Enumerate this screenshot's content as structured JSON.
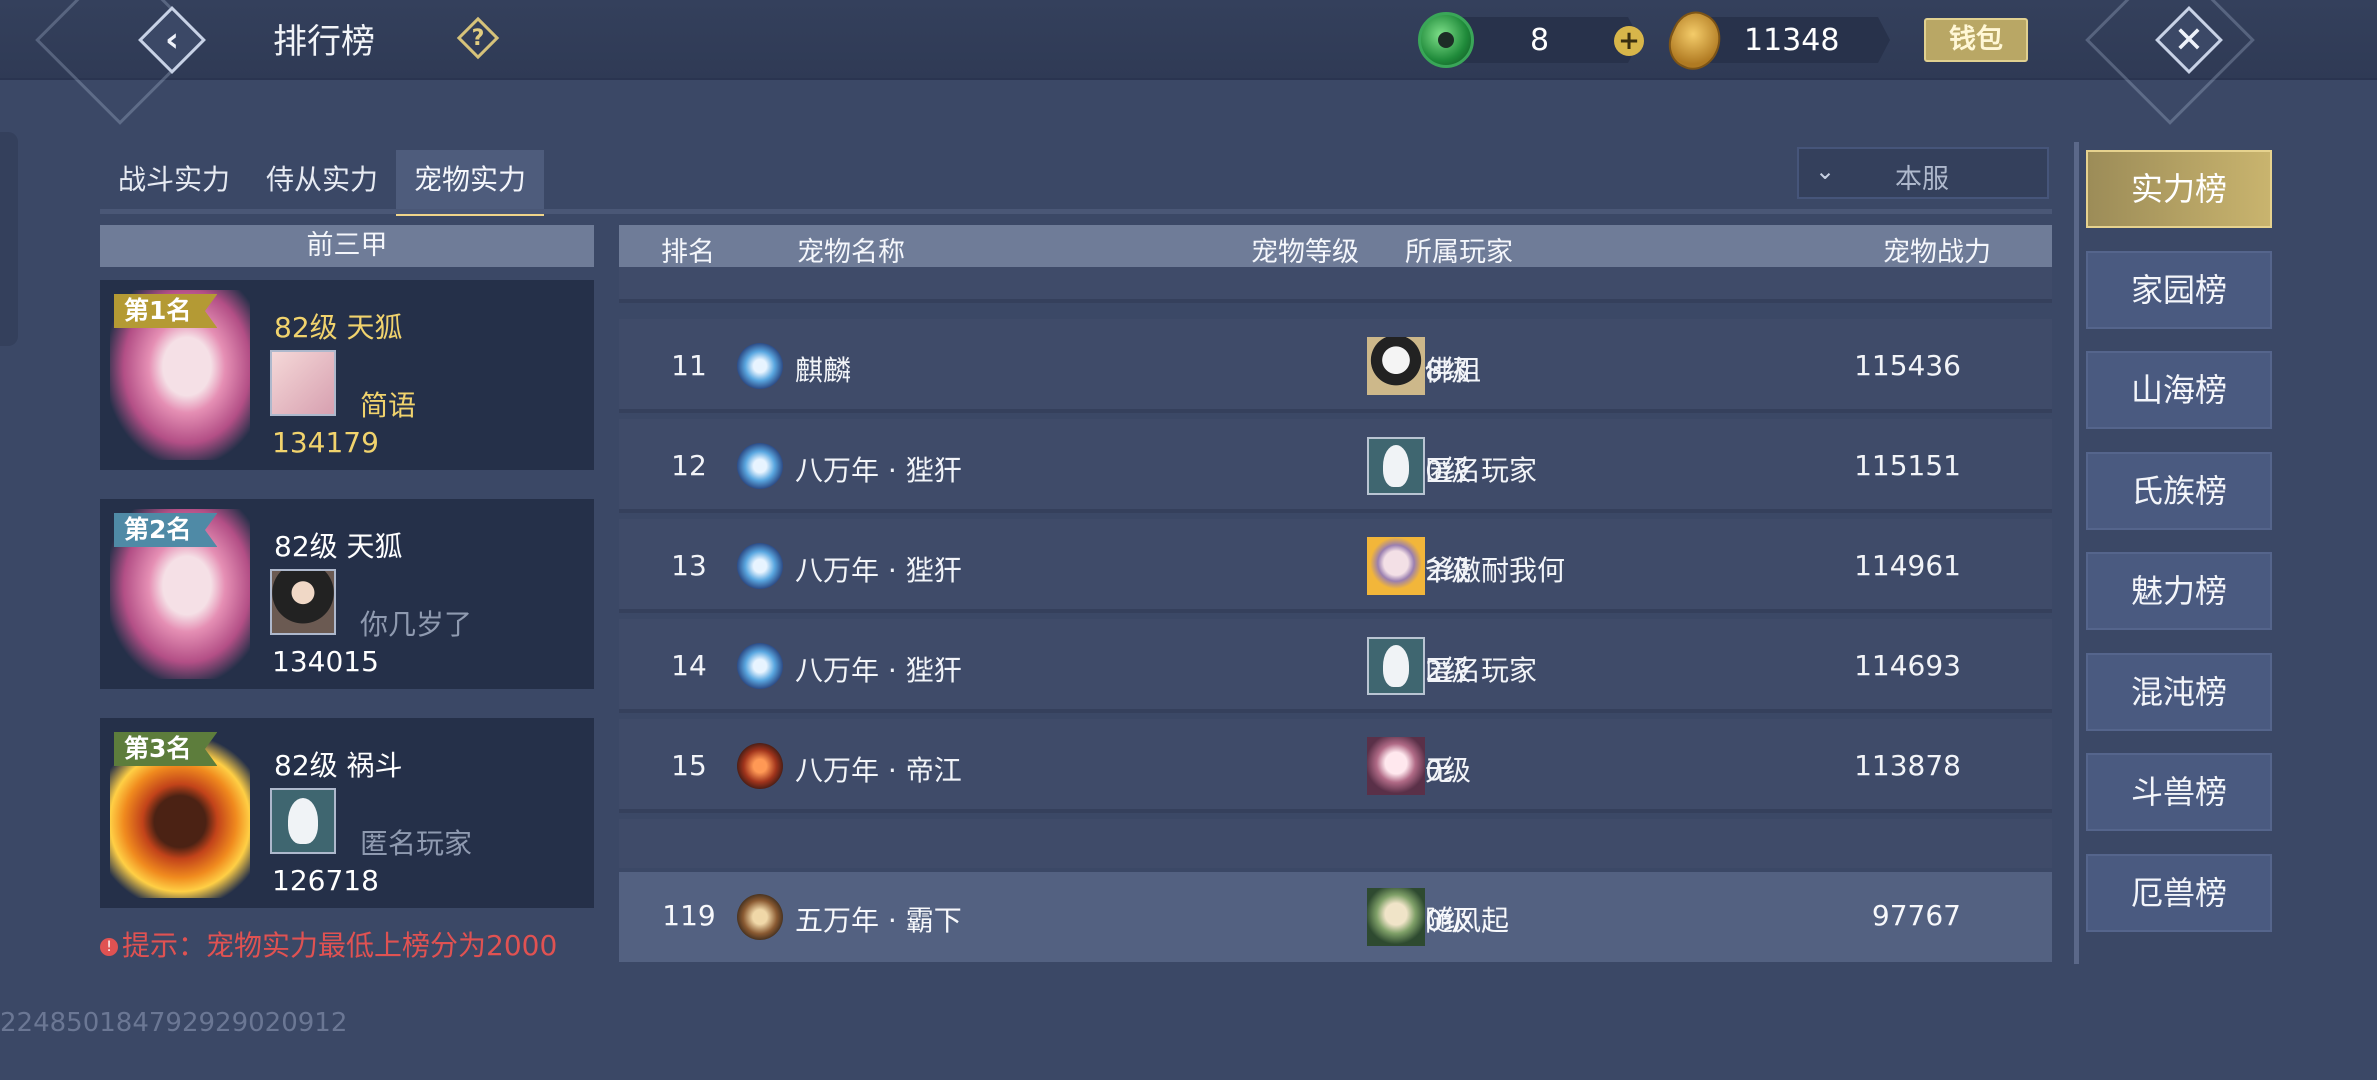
{
  "header": {
    "title": "排行榜",
    "jade_amount": "8",
    "coin_amount": "11348",
    "wallet_label": "钱包"
  },
  "tabs": [
    {
      "label": "战斗实力",
      "active": false
    },
    {
      "label": "侍从实力",
      "active": false
    },
    {
      "label": "宠物实力",
      "active": true
    }
  ],
  "server_filter": {
    "selected": "本服"
  },
  "top_three": {
    "header": "前三甲",
    "entries": [
      {
        "rank_label": "第1名",
        "level_name": "82级 天狐",
        "player": "简语",
        "power": "134179"
      },
      {
        "rank_label": "第2名",
        "level_name": "82级 天狐",
        "player": "你几岁了",
        "power": "134015"
      },
      {
        "rank_label": "第3名",
        "level_name": "82级 祸斗",
        "player": "匿名玩家",
        "power": "126718"
      }
    ]
  },
  "tip": "提示：宠物实力最低上榜分为2000",
  "table": {
    "columns": {
      "rank": "排名",
      "pet_name": "宠物名称",
      "pet_level": "宠物等级",
      "player": "所属玩家",
      "power": "宠物战力"
    },
    "rows": [
      {
        "rank": "11",
        "pet": "麒麟",
        "level": "78级",
        "player": "佛祖",
        "power": "115436",
        "pet_icon": "blue-dragon-icon",
        "avatar": "mono"
      },
      {
        "rank": "12",
        "pet": "八万年 · 狴犴",
        "level": "80级",
        "player": "匿名玩家",
        "power": "115151",
        "pet_icon": "blue-beast-icon",
        "avatar": "anon"
      },
      {
        "rank": "13",
        "pet": "八万年 · 狴犴",
        "level": "82级",
        "player": "爷傲耐我何",
        "power": "114961",
        "pet_icon": "blue-beast-icon",
        "avatar": "gold"
      },
      {
        "rank": "14",
        "pet": "八万年 · 狴犴",
        "level": "82级",
        "player": "匿名玩家",
        "power": "114693",
        "pet_icon": "blue-beast-icon",
        "avatar": "anon"
      },
      {
        "rank": "15",
        "pet": "八万年 · 帝江",
        "level": "80级",
        "player": "无",
        "power": "113878",
        "pet_icon": "red-beast-icon",
        "avatar": "pink"
      }
    ],
    "my_row": {
      "rank": "119",
      "pet": "五万年 · 霸下",
      "level": "80级",
      "player": "随风起",
      "power": "97767",
      "pet_icon": "turtle-icon",
      "avatar": "green"
    }
  },
  "side_tabs": [
    {
      "label": "实力榜",
      "active": true
    },
    {
      "label": "家园榜",
      "active": false
    },
    {
      "label": "山海榜",
      "active": false
    },
    {
      "label": "氏族榜",
      "active": false
    },
    {
      "label": "魅力榜",
      "active": false
    },
    {
      "label": "混沌榜",
      "active": false
    },
    {
      "label": "斗兽榜",
      "active": false
    },
    {
      "label": "厄兽榜",
      "active": false
    }
  ],
  "uid": "2248501847929290209​12"
}
